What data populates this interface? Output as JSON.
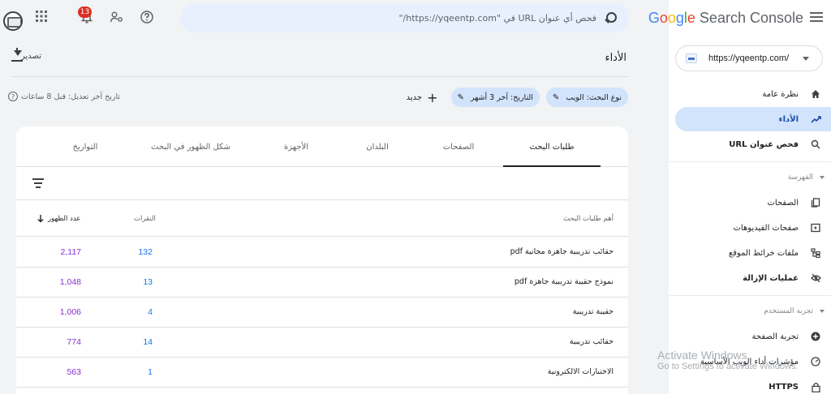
{
  "app": {
    "logo_google": "Google",
    "logo_product": "Search Console",
    "property_url": "https://yqeentp.com/",
    "notification_count": "13"
  },
  "search": {
    "placeholder": "فحص أي عنوان URL في \"https://yqeentp.com/\""
  },
  "sidebar": {
    "items": [
      {
        "label": "نظرة عامة",
        "icon": "home-icon"
      },
      {
        "label": "الأداء",
        "icon": "trending-up-icon"
      },
      {
        "label": "فحص عنوان URL",
        "icon": "search-icon"
      }
    ],
    "index_header": "الفهرسة",
    "index_items": [
      {
        "label": "الصفحات",
        "icon": "pages-icon"
      },
      {
        "label": "صفحات الفيديوهات",
        "icon": "video-icon"
      },
      {
        "label": "ملفات خرائط الموقع",
        "icon": "sitemap-icon"
      },
      {
        "label": "عمليات الإزالة",
        "icon": "eye-off-icon"
      }
    ],
    "experience_header": "تجربة المستخدم",
    "experience_items": [
      {
        "label": "تجربة الصفحة",
        "icon": "plus-circle-icon"
      },
      {
        "label": "مؤشرات أداء الويب الأساسية",
        "icon": "gauge-icon"
      },
      {
        "label": "HTTPS",
        "icon": "lock-icon"
      }
    ]
  },
  "main": {
    "title": "الأداء",
    "export_label": "تصدير",
    "filters": {
      "search_type": "نوع البحث: الويب",
      "date": "التاريخ: آخر 3 أشهر",
      "new_label": "جديد"
    },
    "last_updated": "تاريخ آخر تعديل: قبل 8 ساعات",
    "tabs": [
      "طلبات البحث",
      "الصفحات",
      "البلدان",
      "الأجهزة",
      "شكل الظهور في البحث",
      "التواريخ"
    ],
    "table": {
      "col_query": "أهم طلبات البحث",
      "col_clicks": "النقرات",
      "col_impressions": "عدد الظهور",
      "rows": [
        {
          "query": "حقائب تدريبية جاهزة مجانية pdf",
          "clicks": "132",
          "impressions": "2,117"
        },
        {
          "query": "نموذج حقيبة تدريبية جاهزة pdf",
          "clicks": "13",
          "impressions": "1,048"
        },
        {
          "query": "حقيبة تدريبية",
          "clicks": "4",
          "impressions": "1,006"
        },
        {
          "query": "حقائب تدريبية",
          "clicks": "14",
          "impressions": "774"
        },
        {
          "query": "الاختبارات الالكترونية",
          "clicks": "1",
          "impressions": "563"
        }
      ]
    }
  },
  "watermark": {
    "line1": "Activate Windows",
    "line2": "Go to Settings to activate Windows."
  },
  "colors": {
    "accent": "#1a73e8",
    "impressions": "#8430ce",
    "active_nav": "#d2e3fc",
    "badge": "#d93025"
  }
}
